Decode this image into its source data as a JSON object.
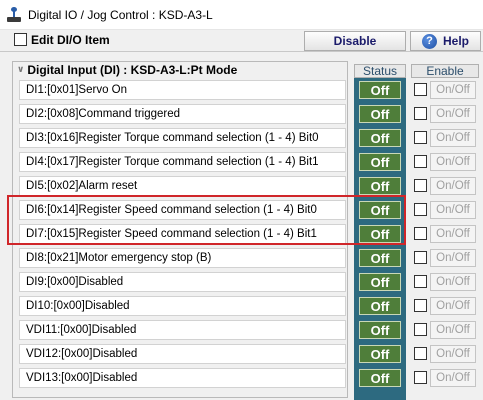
{
  "window": {
    "title": "Digital IO / Jog Control : KSD-A3-L",
    "icon": "joystick-icon"
  },
  "toolbar": {
    "edit_label": "Edit DI/O Item",
    "edit_checked": false,
    "disable_label": "Disable",
    "help_label": "Help",
    "help_icon": "question-icon"
  },
  "panel": {
    "title": "Digital Input (DI) : KSD-A3-L:Pt Mode",
    "status_header": "Status",
    "enable_header": "Enable"
  },
  "rows": [
    {
      "label": "DI1:[0x01]Servo On",
      "status": "Off",
      "enable": "On/Off",
      "enabled_checked": false
    },
    {
      "label": "DI2:[0x08]Command triggered",
      "status": "Off",
      "enable": "On/Off",
      "enabled_checked": false
    },
    {
      "label": "DI3:[0x16]Register Torque command selection (1 - 4) Bit0",
      "status": "Off",
      "enable": "On/Off",
      "enabled_checked": false
    },
    {
      "label": "DI4:[0x17]Register Torque command selection (1 - 4) Bit1",
      "status": "Off",
      "enable": "On/Off",
      "enabled_checked": false
    },
    {
      "label": "DI5:[0x02]Alarm reset",
      "status": "Off",
      "enable": "On/Off",
      "enabled_checked": false
    },
    {
      "label": "DI6:[0x14]Register Speed command selection (1 - 4) Bit0",
      "status": "Off",
      "enable": "On/Off",
      "enabled_checked": false
    },
    {
      "label": "DI7:[0x15]Register Speed command selection (1 - 4) Bit1",
      "status": "Off",
      "enable": "On/Off",
      "enabled_checked": false
    },
    {
      "label": "DI8:[0x21]Motor emergency stop (B)",
      "status": "Off",
      "enable": "On/Off",
      "enabled_checked": false
    },
    {
      "label": "DI9:[0x00]Disabled",
      "status": "Off",
      "enable": "On/Off",
      "enabled_checked": false
    },
    {
      "label": "DI10:[0x00]Disabled",
      "status": "Off",
      "enable": "On/Off",
      "enabled_checked": false
    },
    {
      "label": "VDI11:[0x00]Disabled",
      "status": "Off",
      "enable": "On/Off",
      "enabled_checked": false
    },
    {
      "label": "VDI12:[0x00]Disabled",
      "status": "Off",
      "enable": "On/Off",
      "enabled_checked": false
    },
    {
      "label": "VDI13:[0x00]Disabled",
      "status": "Off",
      "enable": "On/Off",
      "enabled_checked": false
    }
  ],
  "colors": {
    "status_column": "#2d6a80",
    "status_off_bg": "#4f7e3a",
    "highlight_border": "#d0262a"
  }
}
